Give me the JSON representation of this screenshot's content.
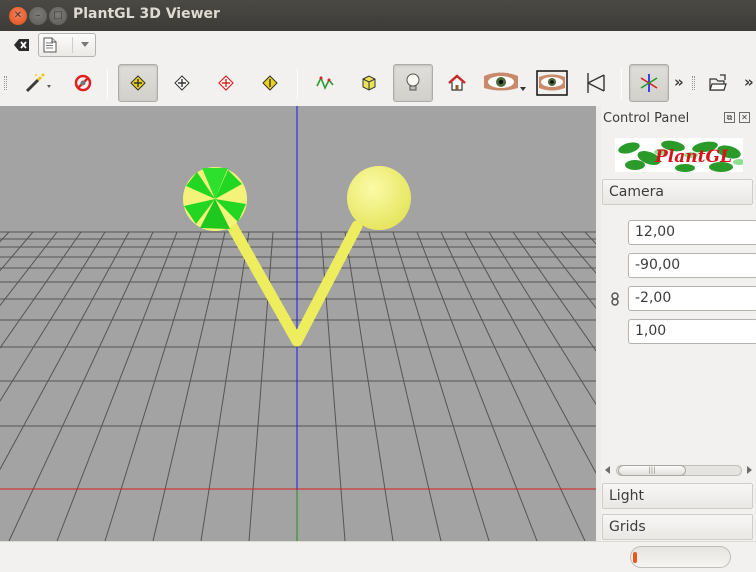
{
  "window": {
    "title": "PlantGL 3D Viewer",
    "close_label": "✕",
    "minimize_label": "–",
    "maximize_label": "□"
  },
  "toolbar": {
    "overflow_label": "»",
    "buttons": [
      {
        "name": "wand-icon"
      },
      {
        "name": "no-action-icon"
      },
      {
        "name": "rotate-mode-icon"
      },
      {
        "name": "select-mode-icon"
      },
      {
        "name": "pick-mode-icon"
      },
      {
        "name": "zoom-mode-icon"
      },
      {
        "name": "curve-icon"
      },
      {
        "name": "box-icon"
      },
      {
        "name": "light-bulb-icon"
      },
      {
        "name": "home-icon"
      },
      {
        "name": "eye-icon"
      },
      {
        "name": "eye-framed-icon"
      },
      {
        "name": "perspective-icon"
      },
      {
        "name": "axes-icon"
      },
      {
        "name": "open-file-icon"
      }
    ]
  },
  "panel": {
    "title": "Control Panel",
    "logo_text": "PlantGL",
    "camera_label": "Camera",
    "camera_values": [
      "12,00",
      "-90,00",
      "-2,00",
      "1,00"
    ],
    "light_label": "Light",
    "grids_label": "Grids",
    "scroll_thumb_grip": "|||"
  },
  "status": {
    "progress": 0.02
  },
  "colors": {
    "viewport_bg": "#a3a3a3",
    "stem": "#eded5e",
    "ball_green": "#1ed21e",
    "ball_yellow": "#f3f37a",
    "axis_blue": "#1a1aff",
    "axis_red": "#d42020",
    "axis_green": "#1f8f1f"
  }
}
